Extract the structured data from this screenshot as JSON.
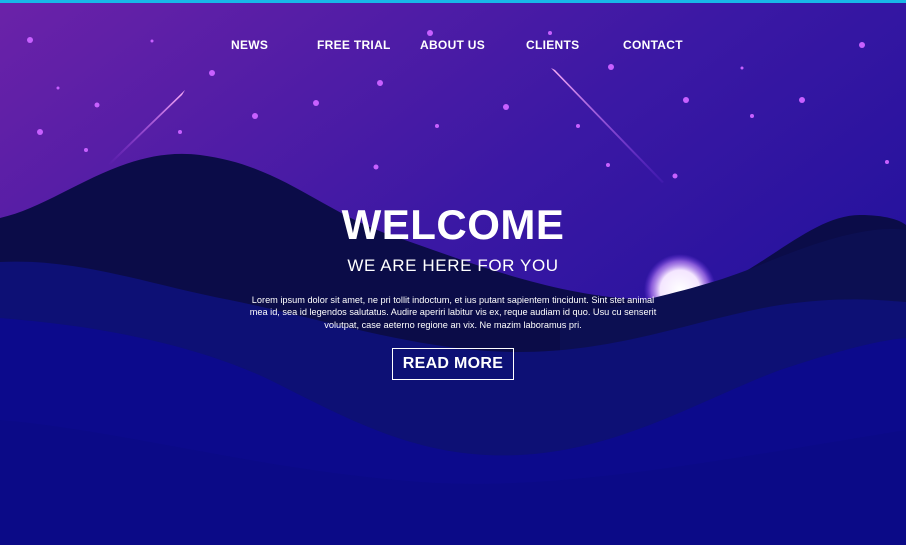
{
  "nav": {
    "items": [
      "NEWS",
      "FREE TRIAL",
      "ABOUT US",
      "CLIENTS",
      "CONTACT"
    ]
  },
  "hero": {
    "title": "WELCOME",
    "subtitle": "WE ARE HERE FOR YOU",
    "body": "Lorem ipsum dolor sit amet, ne pri tollit indoctum, et ius putant sapientem tincidunt. Sint stet animal mea id, sea id legendos salutatus. Audire aperiri labitur vis ex, reque audiam id quo. Usu cu senserit volutpat, case aeterno regione an vix. Ne mazim laboramus pri.",
    "button_label": "READ MORE"
  },
  "colors": {
    "sky_top": "#6a21a6",
    "sky_bottom": "#2b139c",
    "front_wave": "#0d0a8a",
    "dark_hill": "#0c0d4a",
    "accent_line": "#18b7e8"
  },
  "icons": [
    "star-icon",
    "shooting-star-icon",
    "glowing-planet-icon"
  ]
}
